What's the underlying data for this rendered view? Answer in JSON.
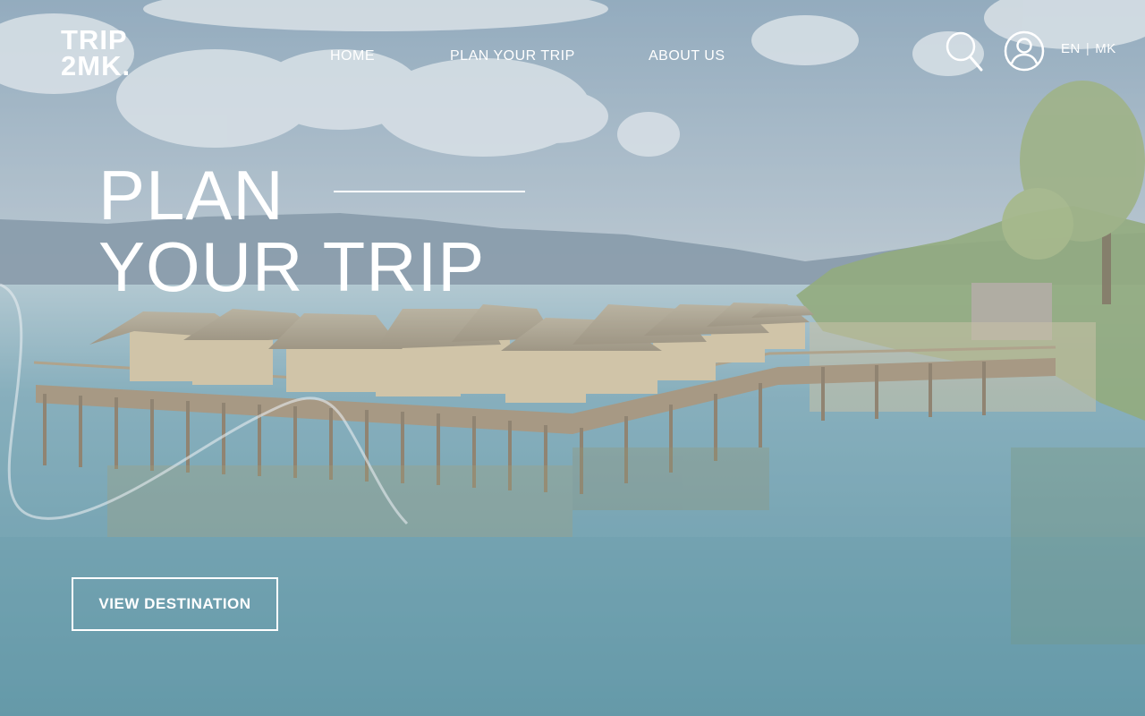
{
  "brand": {
    "logo_line1": "TRIP",
    "logo_line2": "2MK."
  },
  "nav": {
    "items": [
      {
        "label": "HOME"
      },
      {
        "label": "PLAN YOUR TRIP"
      },
      {
        "label": "ABOUT US"
      }
    ]
  },
  "header_actions": {
    "search_icon": "search-icon",
    "account_icon": "user-circle-icon",
    "languages": [
      "EN",
      "MK"
    ],
    "language_separator": "|"
  },
  "hero": {
    "title_line1": "PLAN",
    "title_line2": "YOUR TRIP",
    "cta_label": "VIEW DESTINATION"
  },
  "colors": {
    "text": "#ffffff",
    "sky": "#a9bac8",
    "water": "#4f8e9f",
    "huts": "#d2b98f"
  }
}
